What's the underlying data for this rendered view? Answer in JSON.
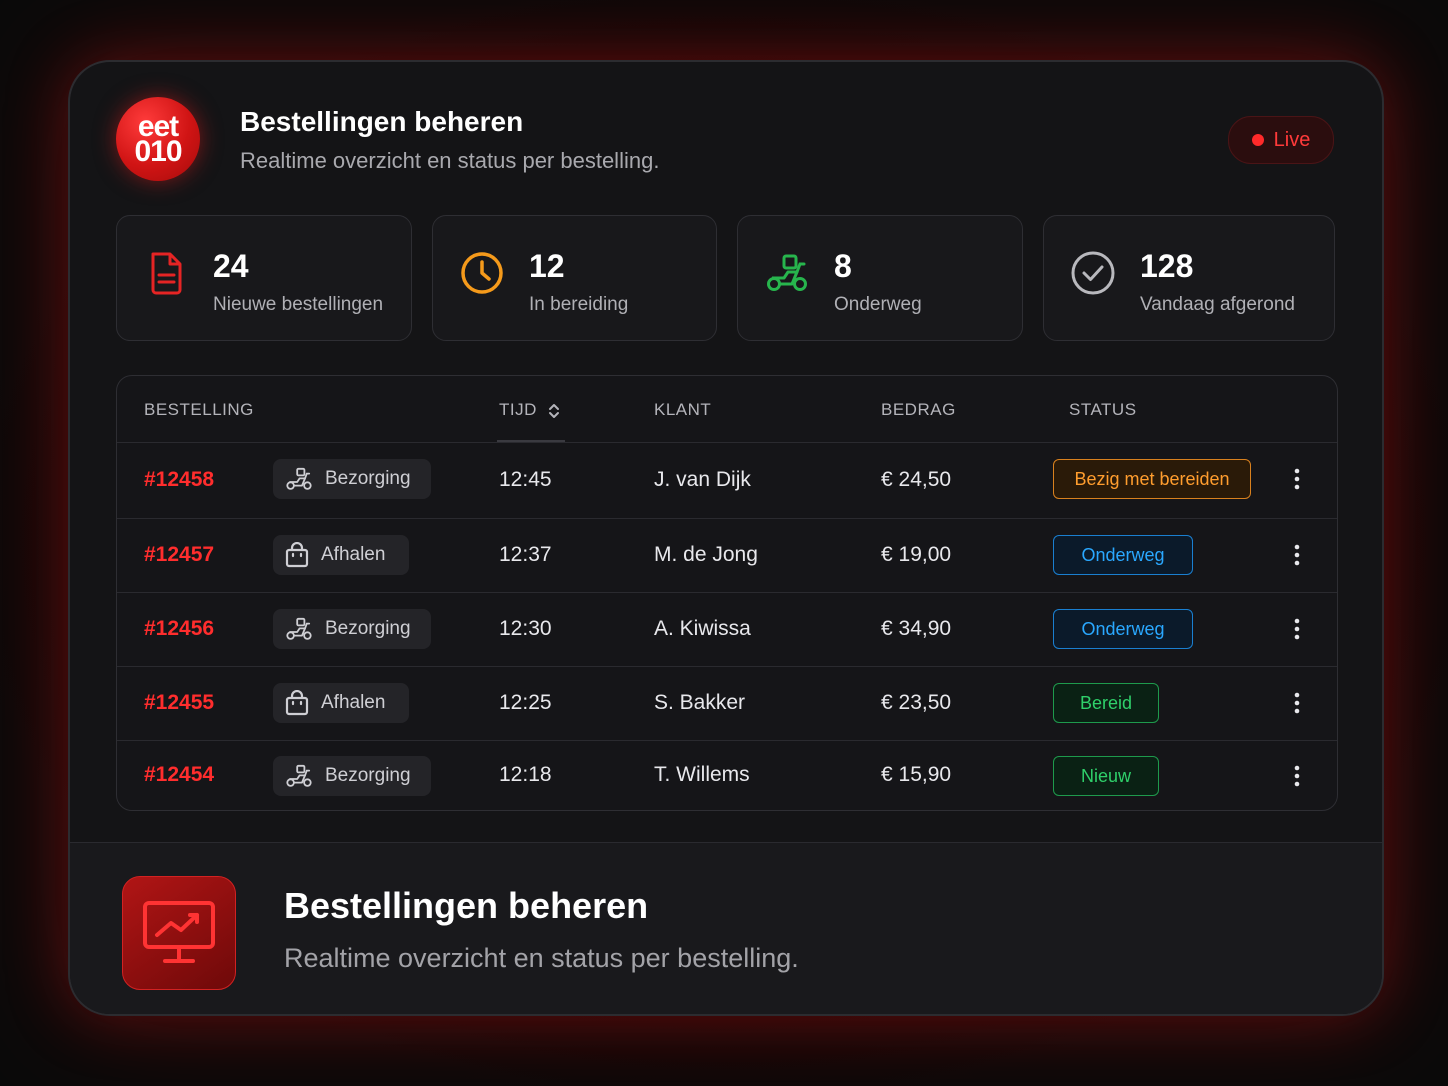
{
  "header": {
    "logo_line1": "eet",
    "logo_line2": "010",
    "title": "Bestellingen beheren",
    "subtitle": "Realtime overzicht en status per bestelling.",
    "live_label": "Live"
  },
  "stats": [
    {
      "value": "24",
      "label": "Nieuwe bestellingen",
      "icon": "document-icon",
      "color": "#e52424"
    },
    {
      "value": "12",
      "label": "In bereiding",
      "icon": "clock-icon",
      "color": "#f59a1b"
    },
    {
      "value": "8",
      "label": "Onderweg",
      "icon": "scooter-icon",
      "color": "#27b54d"
    },
    {
      "value": "128",
      "label": "Vandaag afgerond",
      "icon": "check-circle-icon",
      "color": "#b8b8bd"
    }
  ],
  "table": {
    "columns": [
      "BESTELLING",
      "TIJD",
      "KLANT",
      "BEDRAG",
      "STATUS"
    ],
    "rows": [
      {
        "id": "#12458",
        "type": "Bezorging",
        "type_icon": "scooter-icon",
        "time": "12:45",
        "customer": "J. van Dijk",
        "amount": "€ 24,50",
        "status": "Bezig met bereiden",
        "status_color": "orange"
      },
      {
        "id": "#12457",
        "type": "Afhalen",
        "type_icon": "bag-icon",
        "time": "12:37",
        "customer": "M. de Jong",
        "amount": "€ 19,00",
        "status": "Onderweg",
        "status_color": "blue"
      },
      {
        "id": "#12456",
        "type": "Bezorging",
        "type_icon": "scooter-icon",
        "time": "12:30",
        "customer": "A. Kiwissa",
        "amount": "€ 34,90",
        "status": "Onderweg",
        "status_color": "blue"
      },
      {
        "id": "#12455",
        "type": "Afhalen",
        "type_icon": "bag-icon",
        "time": "12:25",
        "customer": "S. Bakker",
        "amount": "€ 23,50",
        "status": "Bereid",
        "status_color": "green"
      },
      {
        "id": "#12454",
        "type": "Bezorging",
        "type_icon": "scooter-icon",
        "time": "12:18",
        "customer": "T. Willems",
        "amount": "€ 15,90",
        "status": "Nieuw",
        "status_color": "green"
      }
    ]
  },
  "footer": {
    "icon": "monitor-chart-icon",
    "title": "Bestellingen beheren",
    "subtitle": "Realtime overzicht en status per bestelling."
  },
  "colors": {
    "accent": "#ff2d2d",
    "background": "#141416",
    "orange": "#ff9d2e",
    "blue": "#2aa8ff",
    "green": "#2fd06a"
  }
}
